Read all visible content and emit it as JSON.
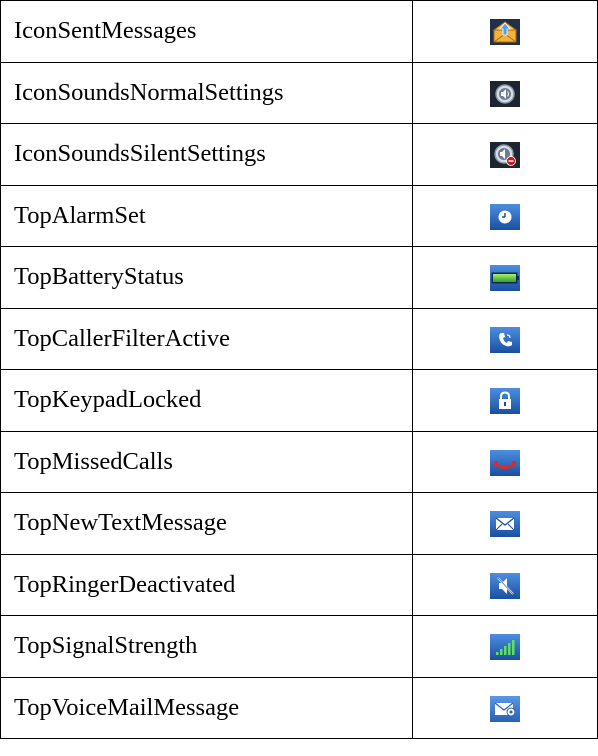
{
  "rows": [
    {
      "label": "IconSentMessages",
      "icon": "sent-messages-icon"
    },
    {
      "label": "IconSoundsNormalSettings",
      "icon": "sound-normal-icon"
    },
    {
      "label": "IconSoundsSilentSettings",
      "icon": "sound-silent-icon"
    },
    {
      "label": "TopAlarmSet",
      "icon": "alarm-clock-icon"
    },
    {
      "label": "TopBatteryStatus",
      "icon": "battery-icon"
    },
    {
      "label": "TopCallerFilterActive",
      "icon": "caller-filter-icon"
    },
    {
      "label": "TopKeypadLocked",
      "icon": "padlock-icon"
    },
    {
      "label": "TopMissedCalls",
      "icon": "missed-call-icon"
    },
    {
      "label": "TopNewTextMessage",
      "icon": "envelope-icon"
    },
    {
      "label": "TopRingerDeactivated",
      "icon": "ringer-muted-icon"
    },
    {
      "label": "TopSignalStrength",
      "icon": "signal-bars-icon"
    },
    {
      "label": "TopVoiceMailMessage",
      "icon": "voicemail-icon"
    }
  ],
  "colors": {
    "icon_dark_bg": "#1d2530",
    "icon_blue_bg": "#1f5db8",
    "icon_blue_light": "#3f80d8",
    "battery_green": "#3cc43c",
    "missed_red": "#e02828",
    "sent_orange": "#f0a020"
  }
}
